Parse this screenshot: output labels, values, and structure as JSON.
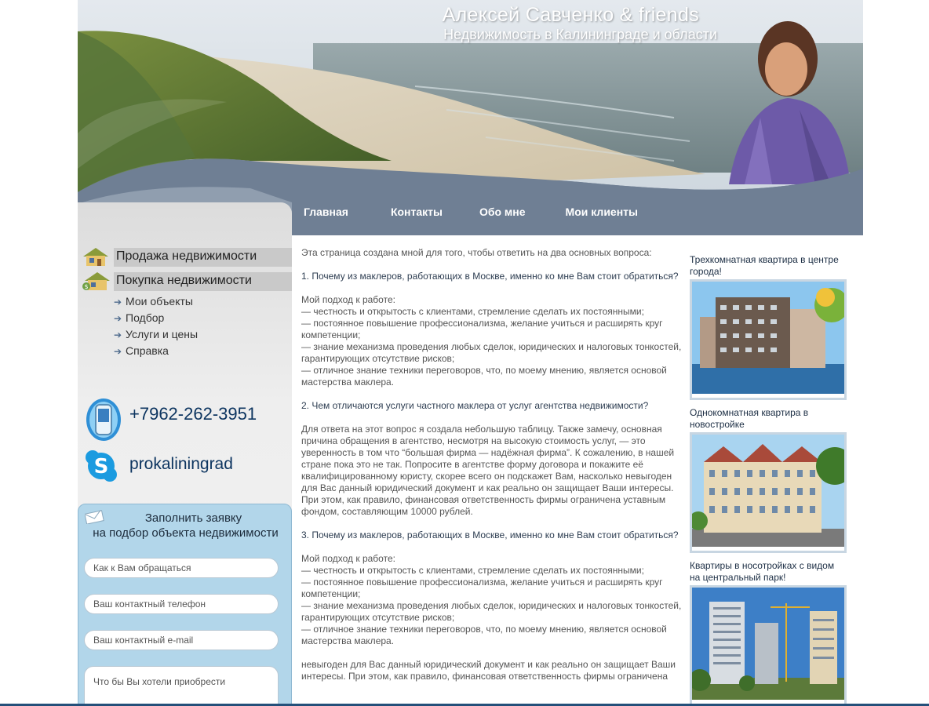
{
  "header": {
    "title": "Алексей Савченко & friends",
    "subtitle": "Недвижимость в Калининграде и области"
  },
  "nav": {
    "items": [
      {
        "label": "Главная"
      },
      {
        "label": "Контакты"
      },
      {
        "label": "Обо мне"
      },
      {
        "label": "Мои клиенты"
      }
    ]
  },
  "sidebar": {
    "categories": [
      {
        "label": "Продажа недвижимости"
      },
      {
        "label": "Покупка недвижимости"
      }
    ],
    "submenu": [
      {
        "label": "Мои объекты"
      },
      {
        "label": "Подбор"
      },
      {
        "label": "Услуги и цены"
      },
      {
        "label": "Справка"
      }
    ],
    "phone": "+7962-262-3951",
    "skype": "prokaliningrad"
  },
  "form": {
    "title_line1": "Заполнить заявку",
    "title_line2": "на подбор объекта недвижимости",
    "name_placeholder": "Как к Вам обращаться",
    "phone_placeholder": "Ваш контактный телефон",
    "email_placeholder": "Ваш контактный e-mail",
    "wish_placeholder": "Что бы Вы хотели приобрести"
  },
  "content": {
    "intro": "Эта страница создана мной для того, чтобы ответить на два основных вопроса:",
    "q1": "1. Почему из маклеров, работающих в Москве, именно ко мне Вам стоит обратиться?",
    "a1_head": "Мой подход к работе:",
    "a1_l1": "— честность и открытость с клиентами, стремление сделать их постоянными;",
    "a1_l2": "— постоянное повышение профессионализма, желание учиться и расширять круг компетенции;",
    "a1_l3": "— знание механизма проведения любых сделок, юридических и налоговых тонкостей, гарантирующих отсутствие рисков;",
    "a1_l4": "— отличное знание техники переговоров, что, по моему мнению, является основой мастерства маклера.",
    "q2": "2. Чем отличаются услуги частного маклера от услуг агентства недвижимости?",
    "a2": "Для ответа на этот вопрос я создала небольшую таблицу. Также замечу, основная причина обращения в агентство, несмотря на высокую стоимость услуг, — это уверенность в том что “большая фирма — надёжная фирма”. К сожалению, в нашей стране пока это не так. Попросите в агентстве форму договора и покажите её квалифицированному юристу, скорее всего он подскажет Вам, насколько невыгоден для Вас данный юридический документ и как реально он защищает Ваши интересы. При этом, как правило, финансовая ответственность фирмы ограничена уставным фондом, составляющим 10000 рублей.",
    "q3": "3. Почему из маклеров, работающих в Москве, именно ко мне Вам стоит обратиться?",
    "a3_head": "Мой подход к работе:",
    "a3_l1": "— честность и открытость с клиентами, стремление сделать их постоянными;",
    "a3_l2": "— постоянное повышение профессионализма, желание учиться и расширять круг компетенции;",
    "a3_l3": "— знание механизма проведения любых сделок, юридических и налоговых тонкостей, гарантирующих отсутствие рисков;",
    "a3_l4": "— отличное знание техники переговоров, что, по моему мнению, является основой мастерства маклера.",
    "tail": "невыгоден для Вас данный юридический документ и как реально он защищает Ваши интересы. При этом, как правило, финансовая ответственность фирмы ограничена"
  },
  "listings": [
    {
      "caption": "Трехкомнатная квартира в центре города!"
    },
    {
      "caption": "Однокомнатная квартира в новостройке"
    },
    {
      "caption": "Квартиры в носотройках с видом на центральный парк!"
    }
  ]
}
